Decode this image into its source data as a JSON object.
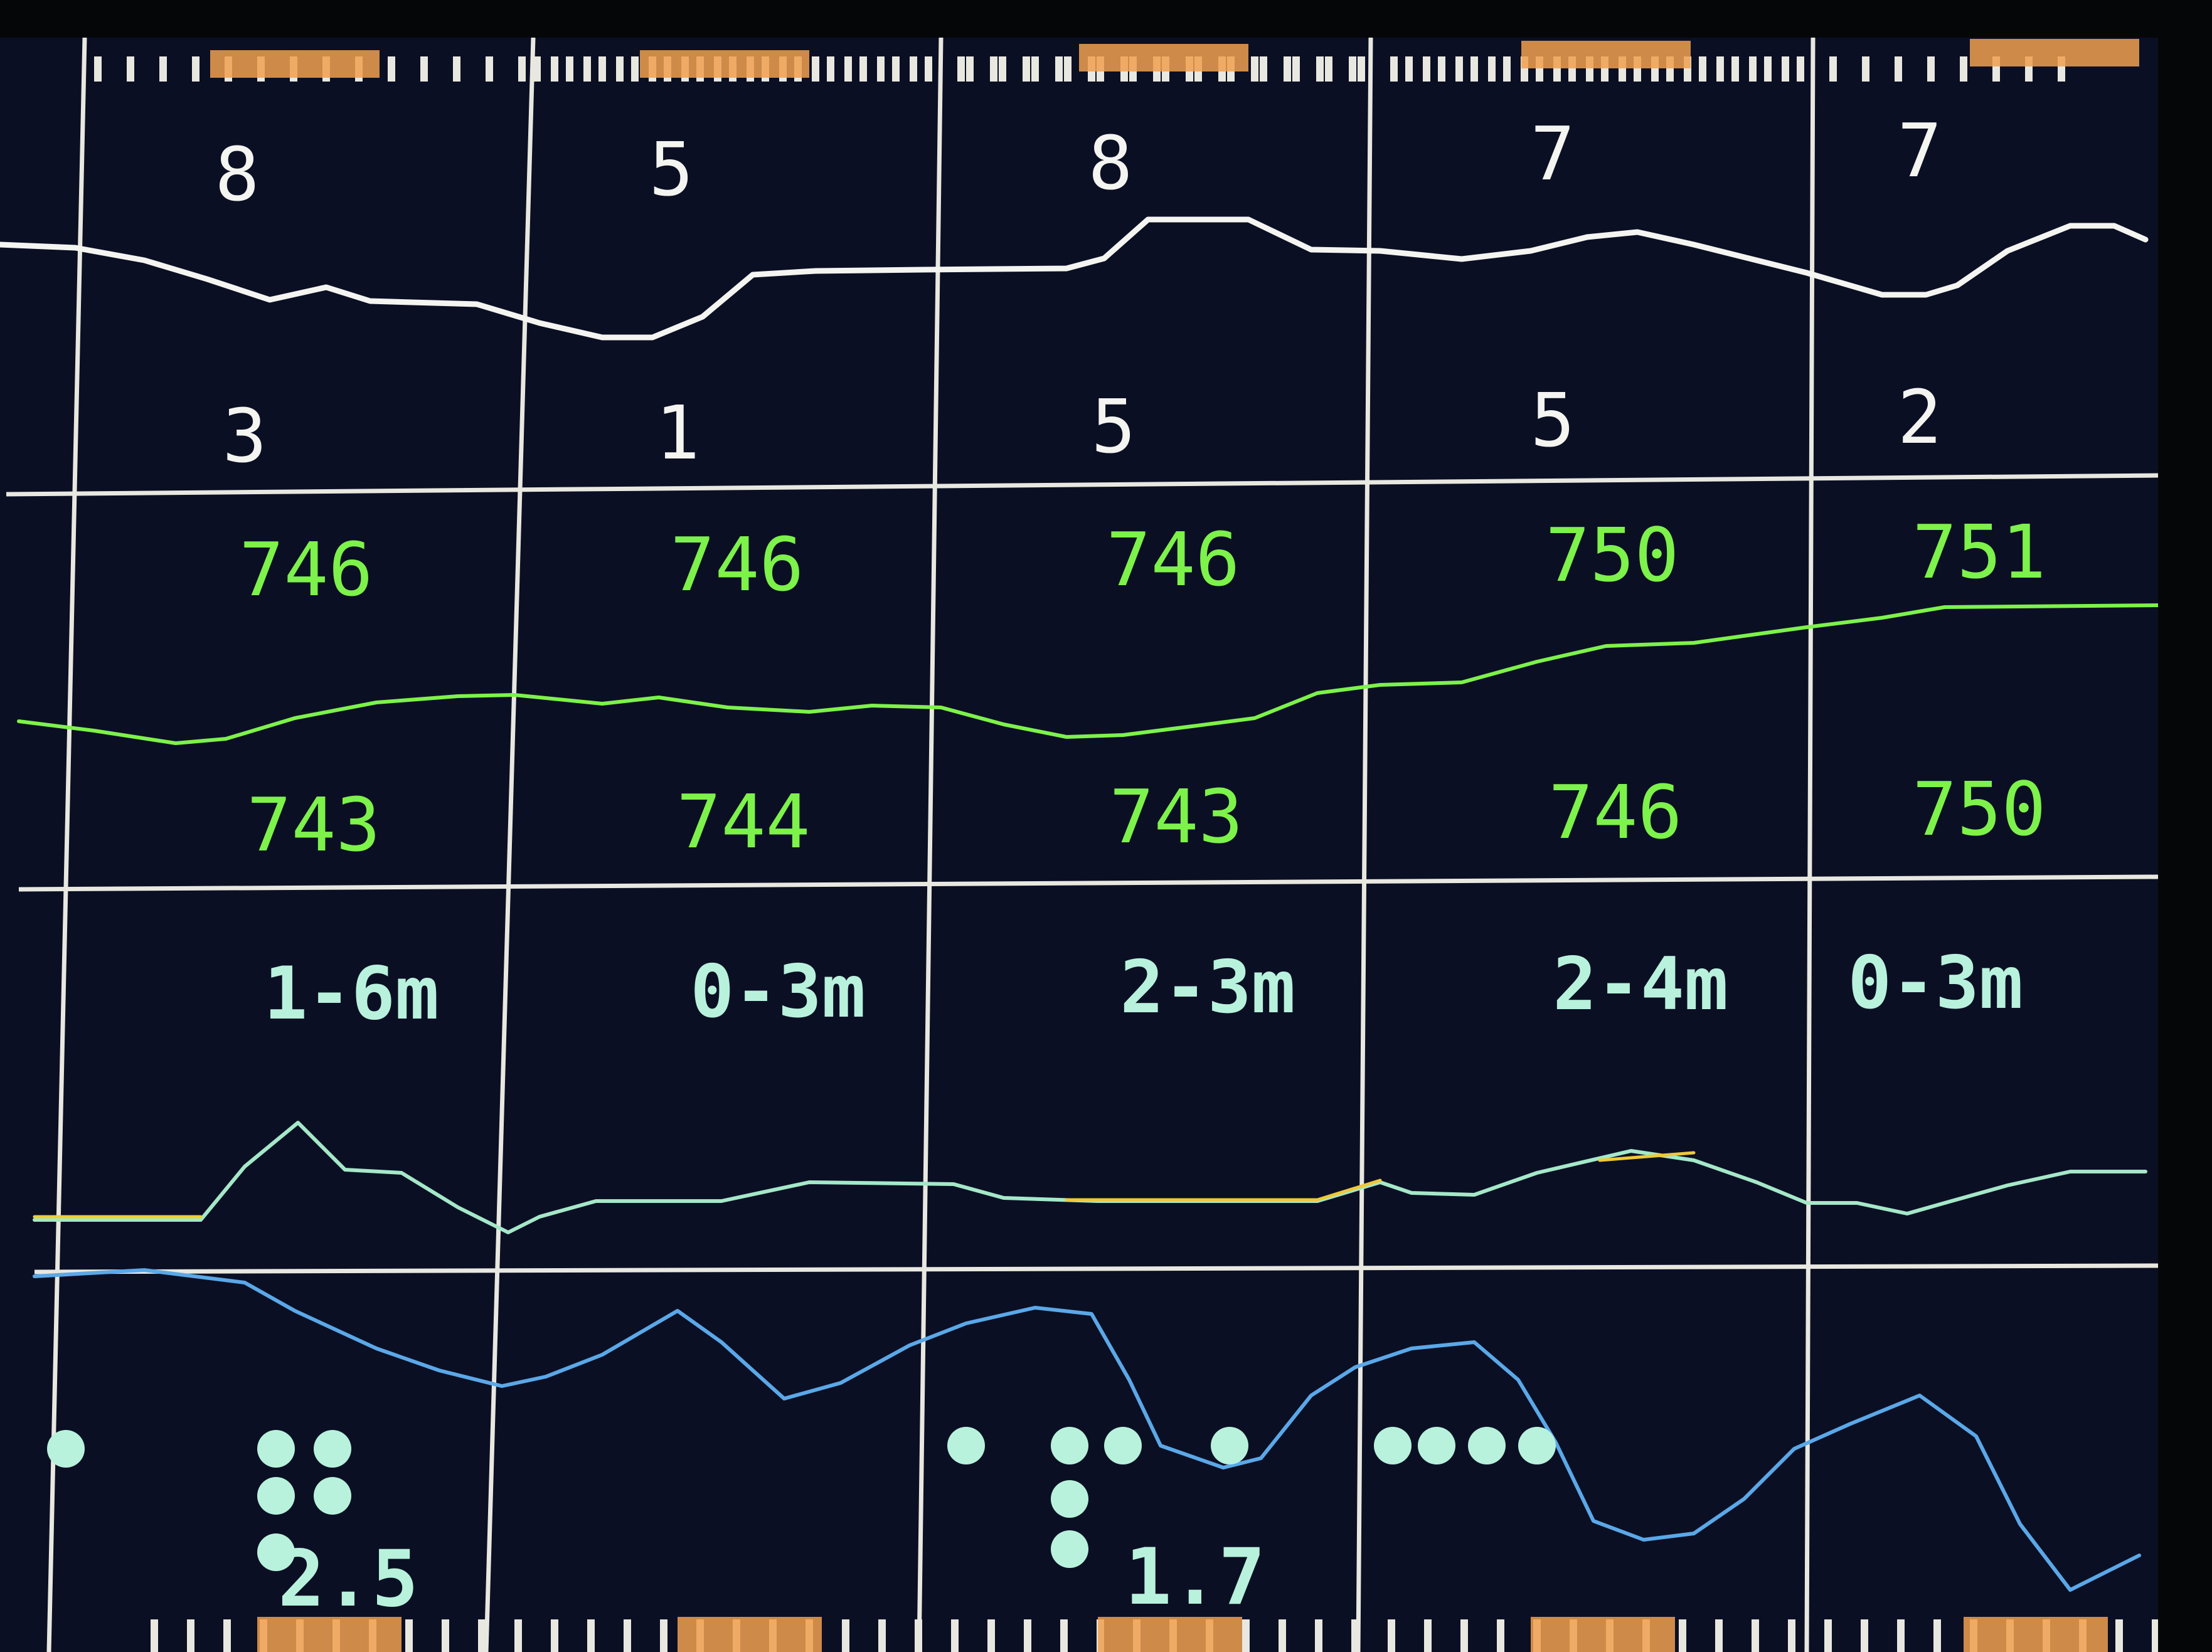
{
  "columns": [
    {
      "wind_max": "8",
      "wind_min": "3",
      "pressure_max": "746",
      "pressure_min": "743",
      "wave_height": "1-6m"
    },
    {
      "wind_max": "5",
      "wind_min": "1",
      "pressure_max": "746",
      "pressure_min": "744",
      "wave_height": "0-3m"
    },
    {
      "wind_max": "8",
      "wind_min": "5",
      "pressure_max": "746",
      "pressure_min": "743",
      "wave_height": "2-3m"
    },
    {
      "wind_max": "7",
      "wind_min": "5",
      "pressure_max": "750",
      "pressure_min": "746",
      "wave_height": "2-4m"
    },
    {
      "wind_max": "7",
      "wind_min": "2",
      "pressure_max": "751",
      "pressure_min": "750",
      "wave_height": "0-3m"
    }
  ],
  "wave_periods": [
    "2.5",
    "1.7"
  ],
  "colors": {
    "background": "#0b0f24",
    "grid": "#e8e8e0",
    "wind": "#f4f4f0",
    "pressure": "#7df24a",
    "wave_label": "#b8f2dc",
    "dot": "#b8f2dc",
    "day_marker": "#f0a050"
  }
}
